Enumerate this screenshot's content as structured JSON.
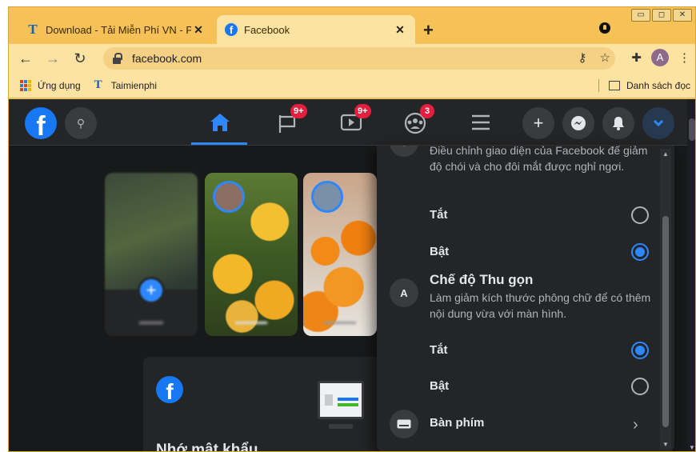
{
  "browser": {
    "tabs": [
      {
        "title": "Download - Tải Miễn Phí VN - Ph",
        "icon": "taimienphi-icon",
        "active": false
      },
      {
        "title": "Facebook",
        "icon": "facebook-icon",
        "active": true
      }
    ],
    "new_tab": "+",
    "url": "facebook.com",
    "profile_initial": "A",
    "bookmarks": [
      {
        "label": "Ứng dụng",
        "icon": "apps-icon"
      },
      {
        "label": "Taimienphi",
        "icon": "taimienphi-icon"
      }
    ],
    "reading_list": "Danh sách đọc"
  },
  "facebook": {
    "logo": "f",
    "badges": {
      "pages": "9+",
      "watch": "9+",
      "groups": "3"
    },
    "stories": [
      {
        "type": "create"
      },
      {
        "type": "friend"
      },
      {
        "type": "friend"
      }
    ],
    "card": {
      "title": "Nhớ mật khẩu",
      "logo": "f"
    }
  },
  "display_panel": {
    "dark_mode": {
      "description": "Điều chỉnh giao diện của Facebook để giảm độ chói và cho đôi mắt được nghỉ ngơi.",
      "options": [
        {
          "label": "Tắt",
          "selected": false
        },
        {
          "label": "Bật",
          "selected": true
        }
      ]
    },
    "compact_mode": {
      "title": "Chế độ Thu gọn",
      "description": "Làm giảm kích thước phông chữ để có thêm nội dung vừa với màn hình.",
      "options": [
        {
          "label": "Tắt",
          "selected": true
        },
        {
          "label": "Bật",
          "selected": false
        }
      ]
    },
    "keyboard": {
      "title": "Bàn phím"
    }
  },
  "colors": {
    "facebook_blue": "#1877f2",
    "accent": "#2d88ff",
    "badge_red": "#e41e3f",
    "chrome_theme": "#f6c156"
  }
}
